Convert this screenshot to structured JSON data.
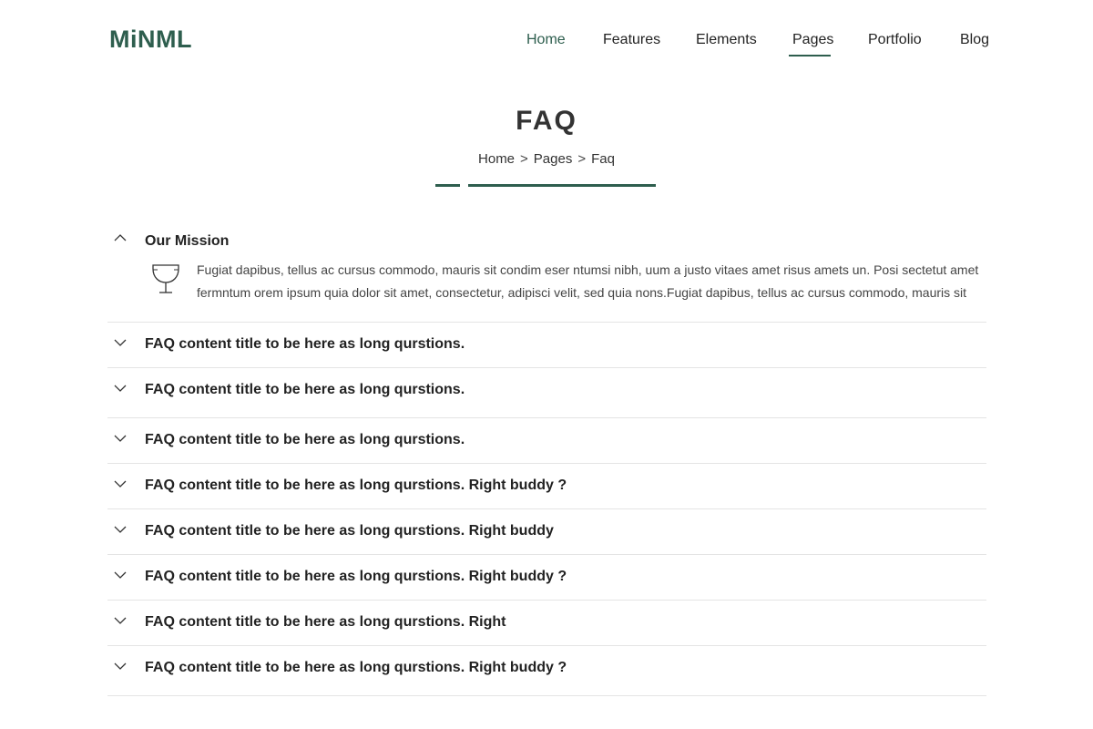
{
  "brand": {
    "logo": "MiNML",
    "accent": "#2e5e4e"
  },
  "nav": {
    "items": [
      "Home",
      "Features",
      "Elements",
      "Pages",
      "Portfolio",
      "Blog"
    ],
    "active": "Home",
    "current": "Pages"
  },
  "page": {
    "title": "FAQ",
    "breadcrumb": [
      "Home",
      "Pages",
      "Faq"
    ],
    "separator": ">"
  },
  "faq": {
    "open": {
      "title": "Our Mission",
      "icon": "trophy-icon",
      "body": "Fugiat dapibus, tellus ac cursus commodo, mauris sit condim eser ntumsi nibh, uum a justo vitaes amet risus amets un. Posi sectetut amet fermntum orem ipsum quia dolor sit amet, consectetur, adipisci velit, sed quia nons.Fugiat dapibus, tellus ac cursus commodo, mauris sit"
    },
    "items": [
      "FAQ content title to be here as long qurstions.",
      "FAQ content title to be here as long qurstions.",
      "FAQ content title to be here as long qurstions.",
      "FAQ content title to be here as long qurstions. Right buddy ?",
      "FAQ content title to be here as long qurstions. Right buddy",
      "FAQ content title to be here as long qurstions. Right buddy ?",
      "FAQ content title to be here as long qurstions. Right",
      "FAQ content title to be here as long qurstions. Right buddy ?"
    ]
  }
}
